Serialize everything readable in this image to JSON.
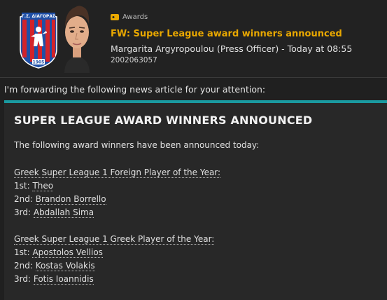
{
  "header": {
    "tag_label": "Awards",
    "subject": "FW: Super League award winners announced",
    "sender_line": "Margarita Argyropoulou (Press Officer) - Today at 08:55",
    "message_id": "2002063057",
    "crest": {
      "name": "Γ.Σ. ΔΙΑΓΟΡΑΣ",
      "year": "1905",
      "colors": [
        "#1f4fa6",
        "#d2232a"
      ]
    },
    "accent_color": "#e9a800"
  },
  "intro_text": "I'm forwarding the following news article for your attention:",
  "article": {
    "accent_color": "#1a9aa0",
    "title": "SUPER LEAGUE AWARD WINNERS ANNOUNCED",
    "intro": "The following award winners have been announced today:",
    "sections": [
      {
        "award": "Greek Super League 1 Foreign Player of the Year:",
        "winners": [
          {
            "place": "1st:",
            "name": "Theo"
          },
          {
            "place": "2nd:",
            "name": "Brandon Borrello"
          },
          {
            "place": "3rd:",
            "name": "Abdallah Sima"
          }
        ]
      },
      {
        "award": "Greek Super League 1 Greek Player of the Year:",
        "winners": [
          {
            "place": "1st:",
            "name": "Apostolos Vellios"
          },
          {
            "place": "2nd:",
            "name": "Kostas Volakis"
          },
          {
            "place": "3rd:",
            "name": "Fotis Ioannidis"
          }
        ]
      }
    ]
  }
}
